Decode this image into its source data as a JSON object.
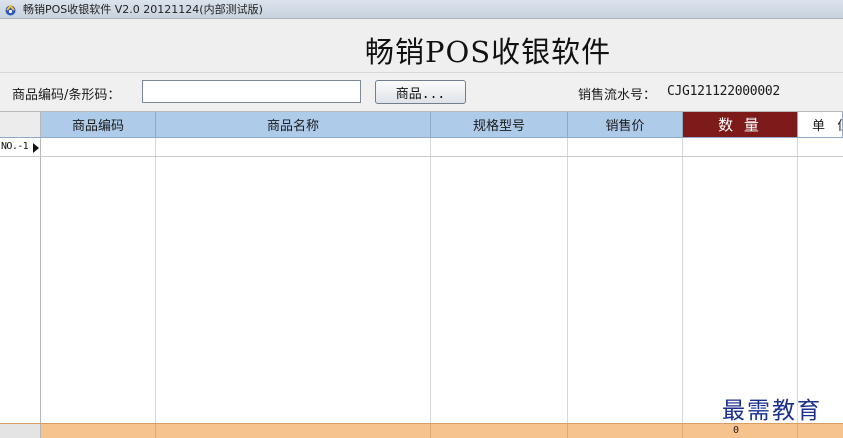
{
  "window": {
    "title": "畅销POS收银软件 V2.0 20121124(内部测试版)"
  },
  "banner": {
    "title": "畅销POS收银软件"
  },
  "toolbar": {
    "barcode_label": "商品编码/条形码：",
    "barcode_value": "",
    "product_button_label": "商品...",
    "serial_label": "销售流水号：",
    "serial_value": "CJG121122000002"
  },
  "grid": {
    "columns": [
      "商品编码",
      "商品名称",
      "规格型号",
      "销售价",
      "数 量",
      "单 位"
    ],
    "rows": [
      {
        "label": "NO.-1",
        "cells": [
          "",
          "",
          "",
          "",
          "",
          ""
        ]
      }
    ],
    "footer": {
      "quantity_total": "0"
    },
    "colors": {
      "header_bg": "#aecbea",
      "quantity_header_bg": "#7d1a1a",
      "footer_bg": "#f6c38e"
    }
  },
  "watermark": {
    "text": "最需教育"
  }
}
